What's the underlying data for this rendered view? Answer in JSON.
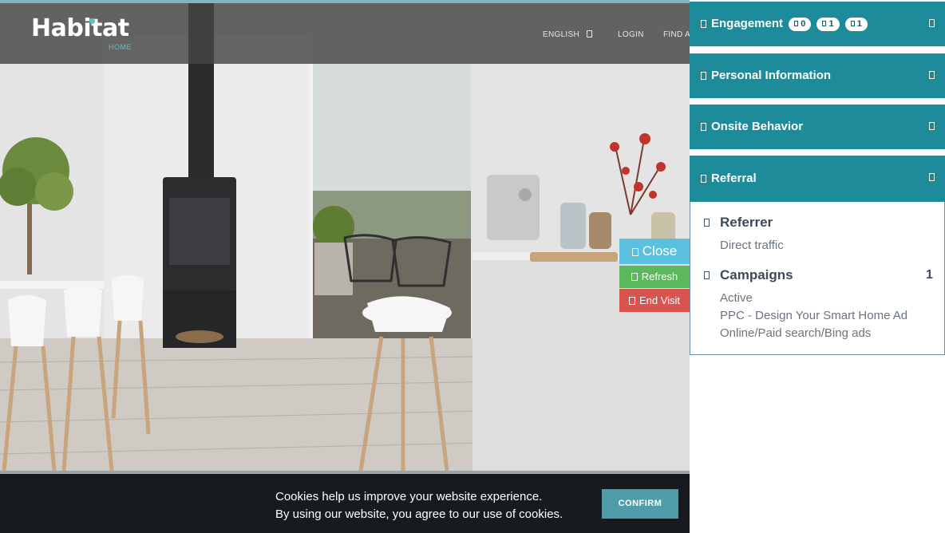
{
  "site": {
    "logo": "Habitat",
    "logo_sub": "HOME",
    "nav": {
      "language": "ENGLISH",
      "login": "LOGIN",
      "find": "FIND A"
    },
    "colors": {
      "accent": "#5fc0cf",
      "header_overlay": "#464646"
    }
  },
  "tools": {
    "close": "Close",
    "refresh": "Refresh",
    "end_visit": "End Visit",
    "colors": {
      "close": "#5bc0de",
      "refresh": "#5cb85c",
      "end_visit": "#d9534f"
    }
  },
  "cookie": {
    "line1": "Cookies help us improve your website experience.",
    "line2": "By using our website, you agree to our use of cookies.",
    "confirm": "CONFIRM"
  },
  "panel": {
    "header_color": "#1d8b99",
    "sections": {
      "engagement": {
        "title": "Engagement",
        "badges": [
          "0",
          "1",
          "1"
        ]
      },
      "personal": {
        "title": "Personal Information"
      },
      "onsite": {
        "title": "Onsite Behavior"
      },
      "referral": {
        "title": "Referral"
      }
    },
    "referral": {
      "referrer": {
        "title": "Referrer",
        "value": "Direct traffic"
      },
      "campaigns": {
        "title": "Campaigns",
        "count": "1",
        "status": "Active",
        "name": "PPC - Design Your Smart Home Ad",
        "channel": "Online/Paid search/Bing ads"
      }
    }
  }
}
